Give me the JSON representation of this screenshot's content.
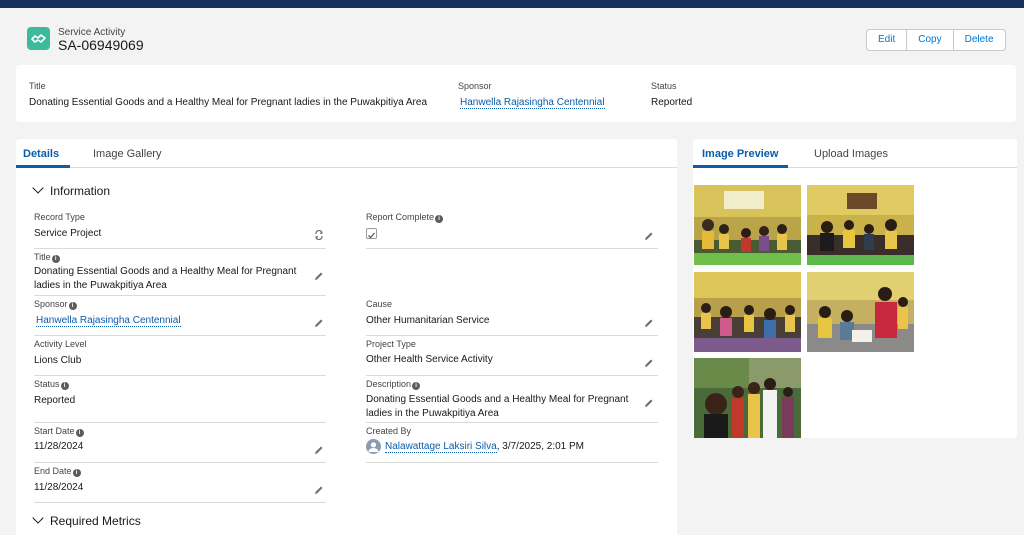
{
  "header": {
    "object_label": "Service Activity",
    "record_name": "SA-06949069",
    "icon": "handshake-icon",
    "accent": "#3bba9c",
    "actions": {
      "edit": "Edit",
      "copy": "Copy",
      "delete": "Delete"
    }
  },
  "highlights": {
    "title_label": "Title",
    "title_value": "Donating Essential Goods and a Healthy Meal for Pregnant ladies in the Puwakpitiya Area",
    "sponsor_label": "Sponsor",
    "sponsor_value": "Hanwella Rajasingha Centennial",
    "status_label": "Status",
    "status_value": "Reported"
  },
  "main_tabs": {
    "details": "Details",
    "gallery": "Image Gallery"
  },
  "sections": {
    "information": "Information",
    "metrics": "Required Metrics"
  },
  "fields": {
    "record_type": {
      "label": "Record Type",
      "value": "Service Project"
    },
    "report_complete": {
      "label": "Report Complete",
      "checked": true
    },
    "title": {
      "label": "Title",
      "line1": "Donating Essential Goods and a Healthy Meal for Pregnant",
      "line2": "ladies in the Puwakpitiya Area"
    },
    "sponsor": {
      "label": "Sponsor",
      "value": "Hanwella Rajasingha Centennial"
    },
    "cause": {
      "label": "Cause",
      "value": "Other Humanitarian Service"
    },
    "activity_level": {
      "label": "Activity Level",
      "value": "Lions Club"
    },
    "project_type": {
      "label": "Project Type",
      "value": "Other Health Service Activity"
    },
    "status": {
      "label": "Status",
      "value": "Reported"
    },
    "description": {
      "label": "Description",
      "line1": "Donating Essential Goods and a Healthy Meal for Pregnant",
      "line2": "ladies in the Puwakpitiya Area"
    },
    "start_date": {
      "label": "Start Date",
      "value": "11/28/2024"
    },
    "created_by": {
      "label": "Created By",
      "user": "Nalawattage Laksiri Silva",
      "when": ", 3/7/2025, 2:01 PM"
    },
    "end_date": {
      "label": "End Date",
      "value": "11/28/2024"
    }
  },
  "side_tabs": {
    "preview": "Image Preview",
    "upload": "Upload Images"
  },
  "colors": {
    "brand": "#0b5cab",
    "topbar": "#16325c"
  }
}
